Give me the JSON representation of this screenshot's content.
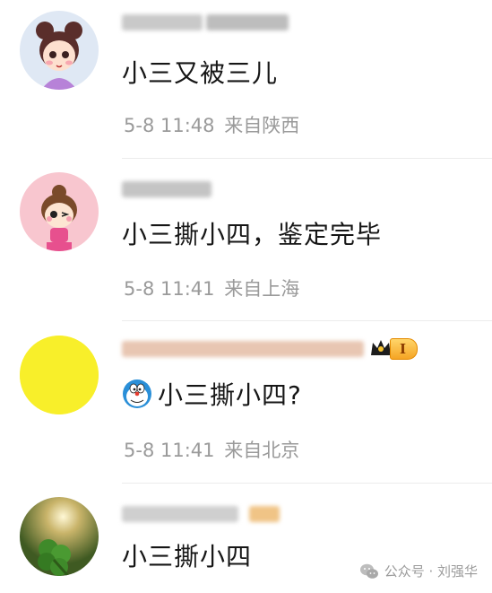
{
  "comments": [
    {
      "text": "小三又被三儿",
      "date": "5-8",
      "time": "11:48",
      "location": "来自陕西",
      "avatar": "cartoon-girl-purple-avatar"
    },
    {
      "text": "小三撕小四，鉴定完毕",
      "date": "5-8",
      "time": "11:41",
      "location": "来自上海",
      "avatar": "cartoon-girl-pink-avatar"
    },
    {
      "text": "小三撕小四?",
      "date": "5-8",
      "time": "11:41",
      "location": "来自北京",
      "avatar": "yellow-circle-avatar",
      "emoji": "doraemon-icon",
      "badge_level": "I"
    },
    {
      "text": "小三撕小四",
      "avatar": "clover-photo-avatar"
    }
  ],
  "watermark": {
    "text": "公众号 · 刘强华",
    "icon": "wechat-icon"
  },
  "colors": {
    "text": "#161616",
    "meta": "#9a9a9a",
    "badge": "#f5a524",
    "avatar_yellow": "#f8ef2a"
  }
}
